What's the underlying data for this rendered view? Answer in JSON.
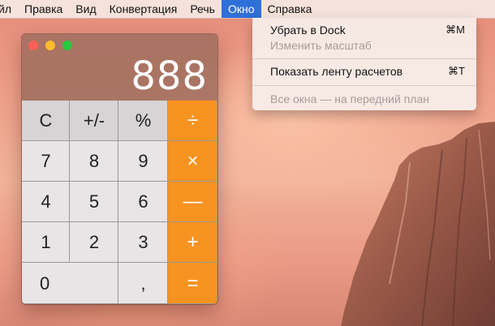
{
  "menubar": {
    "items": [
      "йл",
      "Правка",
      "Вид",
      "Конвертация",
      "Речь",
      "Окно",
      "Справка"
    ],
    "active_index": 5
  },
  "window_menu": {
    "minimize_label": "Убрать в Dock",
    "minimize_shortcut": "⌘M",
    "zoom_label": "Изменить масштаб",
    "show_tape_label": "Показать ленту расчетов",
    "show_tape_shortcut": "⌘T",
    "bring_all_front_label": "Все окна — на передний план"
  },
  "calculator": {
    "display": "888",
    "traffic_lights": [
      "#fc5f57",
      "#fdbc2e",
      "#28c840"
    ],
    "accent_color": "#f79320",
    "keys": {
      "clear": "C",
      "sign": "+/-",
      "percent": "%",
      "divide": "÷",
      "seven": "7",
      "eight": "8",
      "nine": "9",
      "multiply": "×",
      "four": "4",
      "five": "5",
      "six": "6",
      "minus": "—",
      "one": "1",
      "two": "2",
      "three": "3",
      "plus": "+",
      "zero": "0",
      "decimal": ",",
      "equals": "="
    }
  }
}
